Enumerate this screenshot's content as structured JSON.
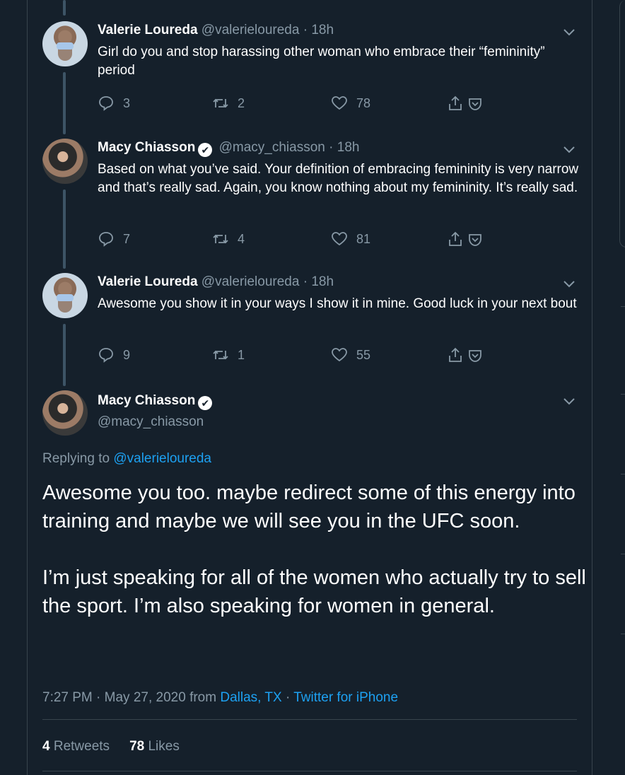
{
  "replies": [
    {
      "name": "Valerie Loureda",
      "handle": "@valerieloureda",
      "time": "18h",
      "text": "Girl do you and stop harassing other woman who embrace their “femininity” period",
      "replies": "3",
      "retweets": "2",
      "likes": "78"
    },
    {
      "name": "Macy Chiasson",
      "handle": "@macy_chiasson",
      "time": "18h",
      "text": "Based on what you’ve said. Your definition of embracing femininity is very narrow and that’s really sad. Again, you know nothing about my femininity. It’s really sad.",
      "replies": "7",
      "retweets": "4",
      "likes": "81"
    },
    {
      "name": "Valerie Loureda",
      "handle": "@valerieloureda",
      "time": "18h",
      "text": "Awesome you show it in your ways I show it in mine. Good luck in your next bout",
      "replies": "9",
      "retweets": "1",
      "likes": "55"
    }
  ],
  "main": {
    "name": "Macy Chiasson",
    "handle": "@macy_chiasson",
    "replying_label": "Replying to",
    "replying_to": "@valerieloureda",
    "paragraph1": "Awesome you too. maybe redirect some of this energy into training and maybe we will see you in the UFC soon.",
    "paragraph2": "I’m just speaking for all of the women who actually try to sell the sport. I’m also speaking for women in general.",
    "time": "7:27 PM",
    "date": "May 27, 2020",
    "from_label": "from",
    "location": "Dallas, TX",
    "source": "Twitter for iPhone",
    "retweets_count": "4",
    "retweets_label": "Retweets",
    "likes_count": "78",
    "likes_label": "Likes"
  },
  "separator": "·",
  "verified_glyph": "✔",
  "colors": {
    "background": "#15202b",
    "text": "#ffffff",
    "secondary": "#8899a6",
    "link": "#1da1f2",
    "border": "#38444d"
  }
}
